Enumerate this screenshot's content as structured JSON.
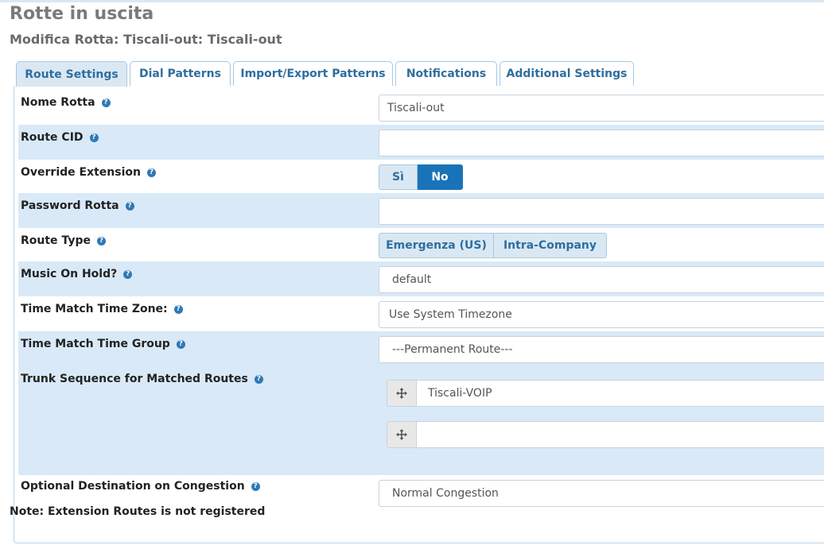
{
  "header": {
    "title": "Rotte in uscita",
    "subtitle": "Modifica Rotta: Tiscali-out: Tiscali-out"
  },
  "tabs": [
    {
      "label": "Route Settings",
      "active": true
    },
    {
      "label": "Dial Patterns",
      "active": false
    },
    {
      "label": "Import/Export Patterns",
      "active": false
    },
    {
      "label": "Notifications",
      "active": false
    },
    {
      "label": "Additional Settings",
      "active": false
    }
  ],
  "form": {
    "route_name": {
      "label": "Nome Rotta",
      "value": "Tiscali-out"
    },
    "route_cid": {
      "label": "Route CID",
      "value": ""
    },
    "override_extension": {
      "label": "Override Extension",
      "options": [
        "Sì",
        "No"
      ],
      "selected": "No"
    },
    "route_password": {
      "label": "Password Rotta",
      "value": ""
    },
    "route_type": {
      "label": "Route Type",
      "options": [
        "Emergenza (US)",
        "Intra-Company"
      ]
    },
    "music_on_hold": {
      "label": "Music On Hold?",
      "value": "default"
    },
    "time_zone": {
      "label": "Time Match Time Zone:",
      "value": "Use System Timezone"
    },
    "time_group": {
      "label": "Time Match Time Group",
      "value": "---Permanent Route---"
    },
    "trunk_sequence": {
      "label": "Trunk Sequence for Matched Routes",
      "trunks": [
        "Tiscali-VOIP",
        ""
      ]
    },
    "congestion_destination": {
      "label": "Optional Destination on Congestion",
      "value": "Normal Congestion"
    }
  },
  "note": "Note: Extension Routes is not registered",
  "icons": {
    "help": "help-icon",
    "drag": "move-arrows-icon"
  },
  "colors": {
    "accent": "#1a73b8",
    "row_alt": "#d9e9f7",
    "tab_text": "#2e6e9e"
  }
}
